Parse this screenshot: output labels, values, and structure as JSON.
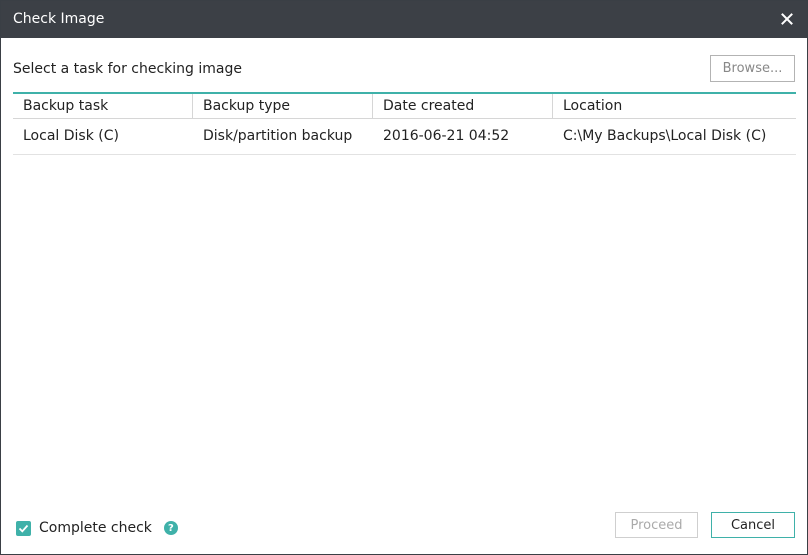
{
  "window": {
    "title": "Check Image"
  },
  "prompt": "Select a task for checking image",
  "browse_label": "Browse...",
  "table": {
    "headers": [
      "Backup task",
      "Backup type",
      "Date created",
      "Location"
    ],
    "rows": [
      [
        "Local Disk (C)",
        "Disk/partition backup",
        "2016-06-21 04:52",
        "C:\\My Backups\\Local Disk (C)"
      ]
    ]
  },
  "footer": {
    "complete_check_label": "Complete check",
    "complete_check_checked": true,
    "help_glyph": "?",
    "proceed_label": "Proceed",
    "cancel_label": "Cancel"
  },
  "colors": {
    "accent": "#3fb1a9",
    "titlebar": "#3c4046"
  },
  "icons": {
    "close": "close-icon",
    "check": "checkmark-icon",
    "help": "help-icon"
  }
}
